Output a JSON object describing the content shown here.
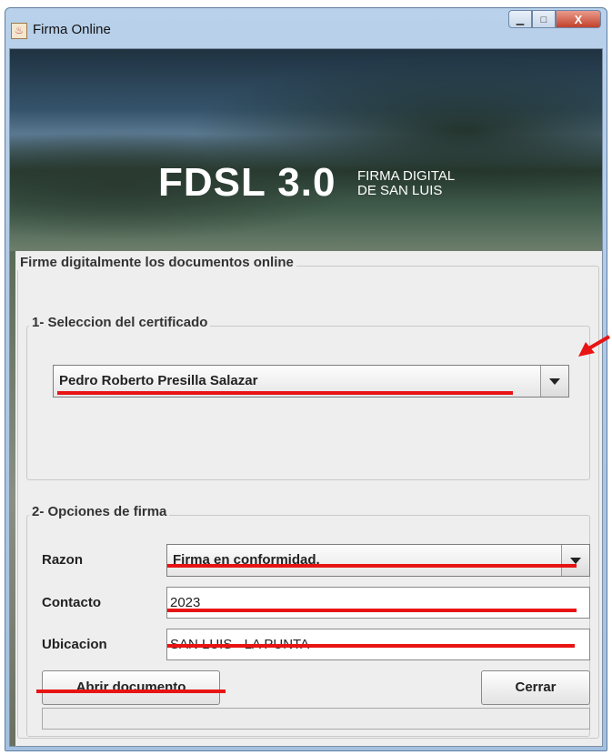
{
  "window": {
    "title": "Firma Online",
    "controls": {
      "minimize": "▁",
      "maximize": "□",
      "close": "X"
    }
  },
  "banner": {
    "title": "FDSL 3.0",
    "subtitle_line1": "FIRMA DIGITAL",
    "subtitle_line2": "DE SAN LUIS"
  },
  "main": {
    "group_title": "Firme digitalmente los documentos online",
    "certificate": {
      "group_title": "1- Seleccion del certificado",
      "selected": "Pedro Roberto Presilla Salazar"
    },
    "options": {
      "group_title": "2- Opciones de firma",
      "razon_label": "Razon",
      "razon_value": "Firma en conformidad.",
      "contacto_label": "Contacto",
      "contacto_value": "2023",
      "ubicacion_label": "Ubicacion",
      "ubicacion_value": "SAN LUIS - LA PUNTA"
    },
    "buttons": {
      "open_label": "Abrir documento",
      "close_label": "Cerrar"
    }
  },
  "colors": {
    "annotation": "#e81414",
    "panel_bg": "#eeeeee",
    "title_bar": "#b9d1ea"
  }
}
